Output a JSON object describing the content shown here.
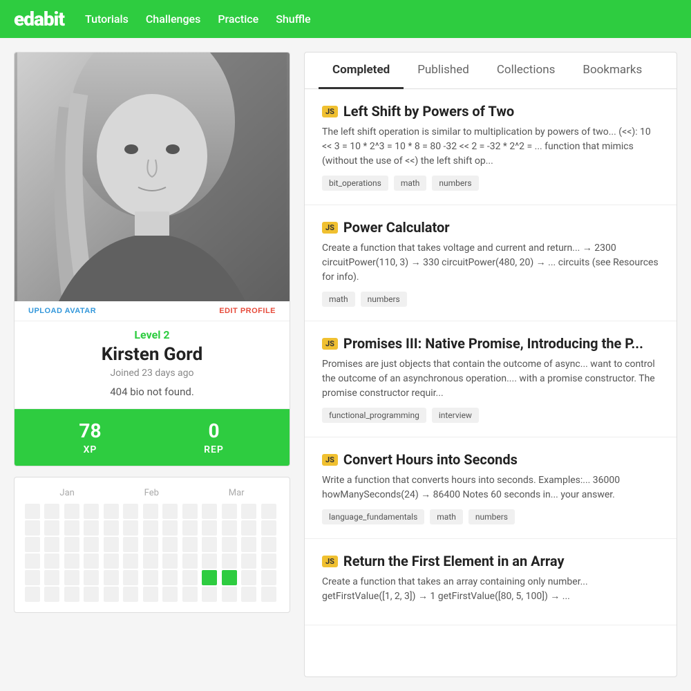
{
  "header": {
    "logo": "edabit",
    "nav": [
      {
        "label": "Tutorials",
        "href": "#"
      },
      {
        "label": "Challenges",
        "href": "#"
      },
      {
        "label": "Practice",
        "href": "#"
      },
      {
        "label": "Shuffle",
        "href": "#"
      }
    ]
  },
  "sidebar": {
    "upload_avatar_label": "UPLOAD AVATAR",
    "edit_profile_label": "EDIT PROFILE",
    "level": "Level 2",
    "user_name": "Kirsten Gord",
    "join_date": "Joined 23 days ago",
    "bio": "404 bio not found.",
    "xp_value": "78",
    "xp_label": "XP",
    "rep_value": "0",
    "rep_label": "REP",
    "calendar": {
      "months": [
        "Jan",
        "Feb",
        "Mar"
      ],
      "active_cells": [
        61,
        62
      ]
    }
  },
  "tabs": [
    {
      "label": "Completed",
      "active": true
    },
    {
      "label": "Published",
      "active": false
    },
    {
      "label": "Collections",
      "active": false
    },
    {
      "label": "Bookmarks",
      "active": false
    }
  ],
  "challenges": [
    {
      "lang": "JS",
      "title": "Left Shift by Powers of Two",
      "desc": "The left shift operation is similar to multiplication by powers of two... (<<): 10 << 3 = 10 * 2^3 = 10 * 8 = 80 -32 << 2 = -32 * 2^2 = ... function that mimics (without the use of <<) the left shift op...",
      "tags": [
        "bit_operations",
        "math",
        "numbers"
      ]
    },
    {
      "lang": "JS",
      "title": "Power Calculator",
      "desc": "Create a function that takes voltage and current and return... → 2300 circuitPower(110, 3) → 330 circuitPower(480, 20) → ... circuits (see Resources for info).",
      "tags": [
        "math",
        "numbers"
      ]
    },
    {
      "lang": "JS",
      "title": "Promises III: Native Promise, Introducing the P...",
      "desc": "Promises are just objects that contain the outcome of async... want to control the outcome of an asynchronous operation.... with a promise constructor. The promise constructor requir...",
      "tags": [
        "functional_programming",
        "interview"
      ]
    },
    {
      "lang": "JS",
      "title": "Convert Hours into Seconds",
      "desc": "Write a function that converts hours into seconds. Examples:... 36000 howManySeconds(24) → 86400 Notes 60 seconds in... your answer.",
      "tags": [
        "language_fundamentals",
        "math",
        "numbers"
      ]
    },
    {
      "lang": "JS",
      "title": "Return the First Element in an Array",
      "desc": "Create a function that takes an array containing only number... getFirstValue([1, 2, 3]) → 1 getFirstValue([80, 5, 100]) → ...",
      "tags": []
    }
  ]
}
